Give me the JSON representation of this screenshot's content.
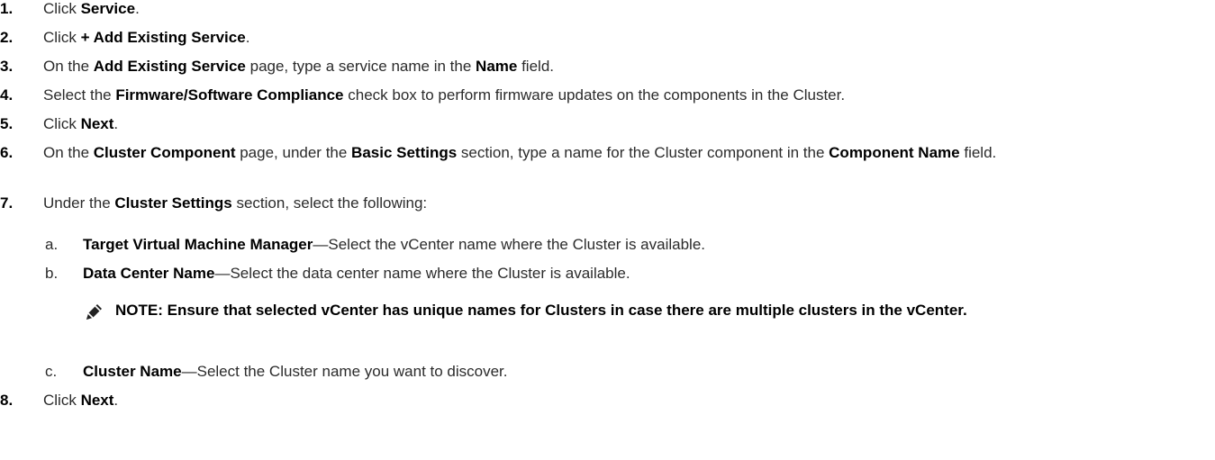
{
  "steps": [
    {
      "num": "1.",
      "parts": [
        {
          "t": "Click "
        },
        {
          "b": "Service"
        },
        {
          "t": "."
        }
      ]
    },
    {
      "num": "2.",
      "parts": [
        {
          "t": "Click "
        },
        {
          "b": "+ Add Existing Service"
        },
        {
          "t": "."
        }
      ]
    },
    {
      "num": "3.",
      "parts": [
        {
          "t": "On the "
        },
        {
          "b": "Add Existing Service"
        },
        {
          "t": " page, type a service name in the "
        },
        {
          "b": "Name"
        },
        {
          "t": " field."
        }
      ]
    },
    {
      "num": "4.",
      "parts": [
        {
          "t": "Select the "
        },
        {
          "b": "Firmware/Software Compliance"
        },
        {
          "t": " check box to perform firmware updates on the components in the Cluster."
        }
      ]
    },
    {
      "num": "5.",
      "parts": [
        {
          "t": "Click "
        },
        {
          "b": "Next"
        },
        {
          "t": "."
        }
      ]
    },
    {
      "num": "6.",
      "parts": [
        {
          "t": "On the "
        },
        {
          "b": "Cluster Component"
        },
        {
          "t": " page, under the "
        },
        {
          "b": "Basic Settings"
        },
        {
          "t": " section, type a name for the Cluster component in the "
        },
        {
          "b": "Component Name"
        },
        {
          "t": " field."
        }
      ]
    },
    {
      "num": "7.",
      "parts": [
        {
          "t": "Under the "
        },
        {
          "b": "Cluster Settings"
        },
        {
          "t": " section, select the following:"
        }
      ]
    }
  ],
  "substeps": [
    {
      "letter": "a.",
      "term": "Target Virtual Machine Manager",
      "desc": "—Select the vCenter name where the Cluster is available."
    },
    {
      "letter": "b.",
      "term": "Data Center Name",
      "desc": "—Select the data center name where the Cluster is available."
    }
  ],
  "note": {
    "icon": "pencil-note-icon",
    "text": "NOTE: Ensure that selected vCenter has unique names for Clusters in case there are multiple clusters in the vCenter."
  },
  "substep_c": {
    "letter": "c.",
    "term": "Cluster Name",
    "desc": "—Select the Cluster name you want to discover."
  },
  "final_step": {
    "num": "8.",
    "parts": [
      {
        "t": "Click "
      },
      {
        "b": "Next"
      },
      {
        "t": "."
      }
    ]
  }
}
